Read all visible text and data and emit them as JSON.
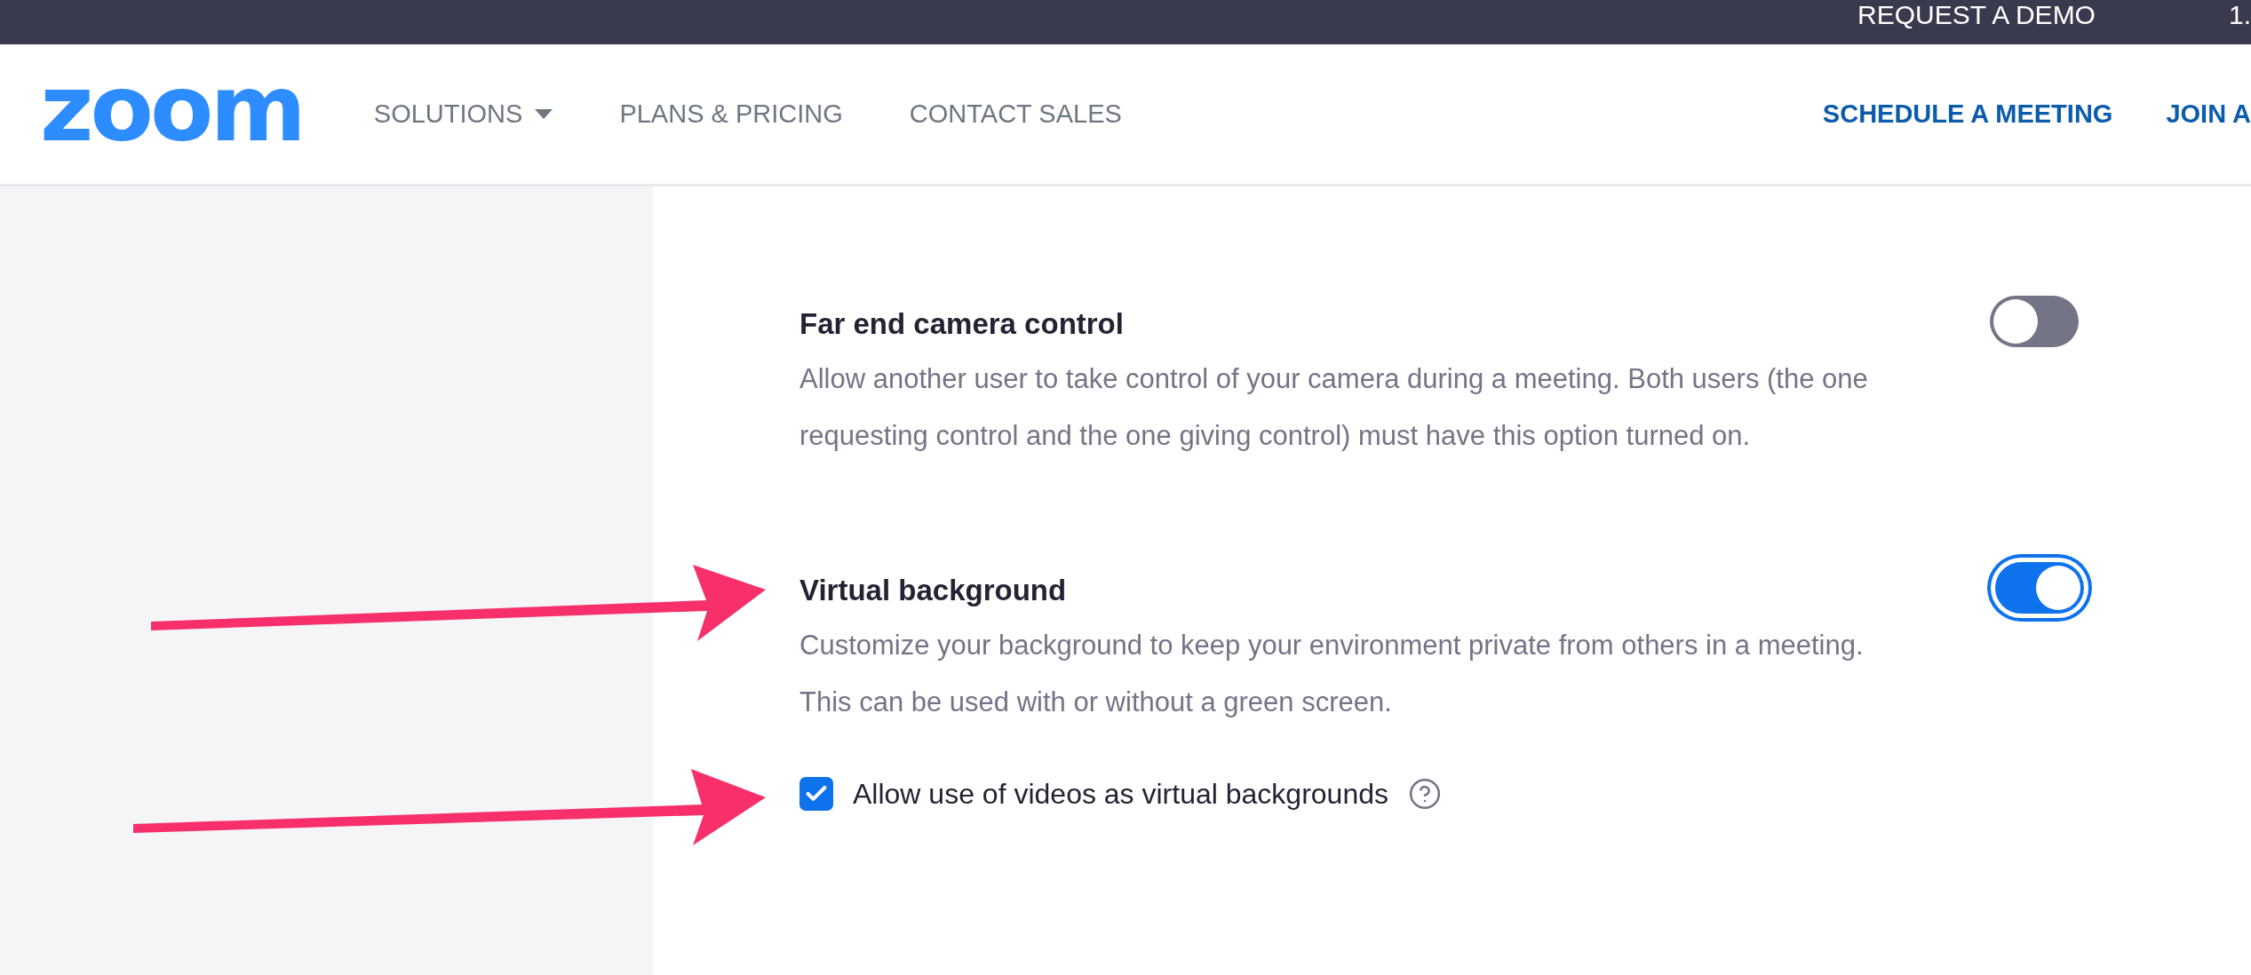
{
  "top_bar": {
    "links": [
      "REQUEST A DEMO",
      "1."
    ]
  },
  "header": {
    "logo": "zoom",
    "nav": [
      {
        "label": "SOLUTIONS",
        "dropdown": true
      },
      {
        "label": "PLANS & PRICING",
        "dropdown": false
      },
      {
        "label": "CONTACT SALES",
        "dropdown": false
      }
    ],
    "actions": [
      "SCHEDULE A MEETING",
      "JOIN A"
    ]
  },
  "settings": [
    {
      "title": "Far end camera control",
      "description": "Allow another user to take control of your camera during a meeting. Both users (the one requesting control and the one giving control) must have this option turned on.",
      "on": false
    },
    {
      "title": "Virtual background",
      "description": "Customize your background to keep your environment private from others in a meeting. This can be used with or without a green screen.",
      "on": true,
      "options": [
        {
          "label": "Allow use of videos as virtual backgrounds",
          "checked": true,
          "help": true
        }
      ]
    }
  ],
  "annotations": [
    {
      "kind": "arrow"
    },
    {
      "kind": "arrow"
    }
  ]
}
